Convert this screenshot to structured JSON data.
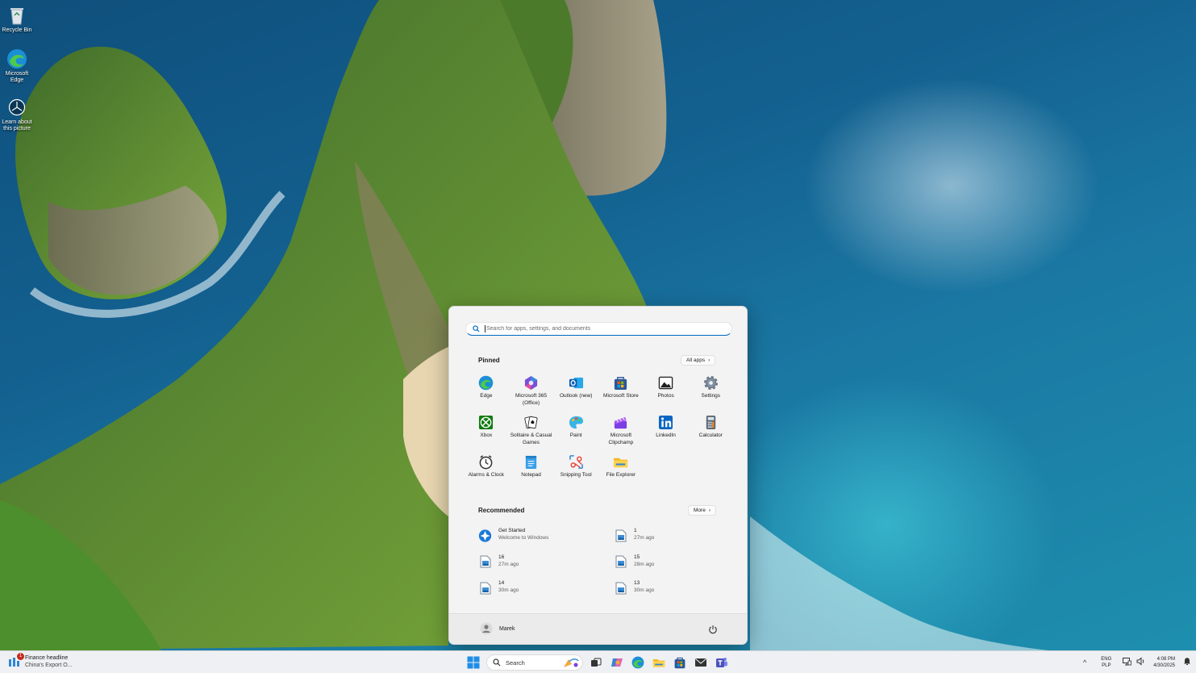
{
  "desktop": {
    "icons": [
      {
        "label": "Recycle Bin",
        "icon": "recycle-bin-icon"
      },
      {
        "label": "Microsoft Edge",
        "icon": "edge-icon"
      },
      {
        "label": "Learn about this picture",
        "icon": "camera-icon"
      }
    ]
  },
  "start_menu": {
    "search_placeholder": "Search for apps, settings, and documents",
    "pinned": {
      "title": "Pinned",
      "all_apps_label": "All apps",
      "apps": [
        {
          "label": "Edge",
          "icon": "edge-icon"
        },
        {
          "label": "Microsoft 365 (Office)",
          "icon": "m365-icon"
        },
        {
          "label": "Outlook (new)",
          "icon": "outlook-icon"
        },
        {
          "label": "Microsoft Store",
          "icon": "store-icon"
        },
        {
          "label": "Photos",
          "icon": "photos-icon"
        },
        {
          "label": "Settings",
          "icon": "gear-icon"
        },
        {
          "label": "Xbox",
          "icon": "xbox-icon"
        },
        {
          "label": "Solitaire & Casual Games",
          "icon": "solitaire-icon"
        },
        {
          "label": "Paint",
          "icon": "paint-icon"
        },
        {
          "label": "Microsoft Clipchamp",
          "icon": "clipchamp-icon"
        },
        {
          "label": "LinkedIn",
          "icon": "linkedin-icon"
        },
        {
          "label": "Calculator",
          "icon": "calculator-icon"
        },
        {
          "label": "Alarms & Clock",
          "icon": "clock-icon"
        },
        {
          "label": "Notepad",
          "icon": "notepad-icon"
        },
        {
          "label": "Snipping Tool",
          "icon": "scissors-icon"
        },
        {
          "label": "File Explorer",
          "icon": "folder-icon"
        }
      ]
    },
    "recommended": {
      "title": "Recommended",
      "more_label": "More",
      "items": [
        {
          "title": "Get Started",
          "subtitle": "Welcome to Windows",
          "icon": "get-started-icon"
        },
        {
          "title": "1",
          "subtitle": "27m ago",
          "icon": "image-file-icon"
        },
        {
          "title": "16",
          "subtitle": "27m ago",
          "icon": "image-file-icon"
        },
        {
          "title": "15",
          "subtitle": "28m ago",
          "icon": "image-file-icon"
        },
        {
          "title": "14",
          "subtitle": "30m ago",
          "icon": "image-file-icon"
        },
        {
          "title": "13",
          "subtitle": "30m ago",
          "icon": "image-file-icon"
        }
      ]
    },
    "user": {
      "name": "Marek"
    }
  },
  "taskbar": {
    "news": {
      "title": "Finance headline",
      "subtitle": "China's Export O...",
      "badge": "1"
    },
    "search_label": "Search",
    "tray": {
      "lang_top": "ENG",
      "lang_bottom": "PLP",
      "time": "4:08 PM",
      "date": "4/30/2025"
    }
  },
  "colors": {
    "accent": "#0067c0",
    "menu_bg": "#f3f3f3",
    "taskbar_bg": "#eef0f3"
  }
}
